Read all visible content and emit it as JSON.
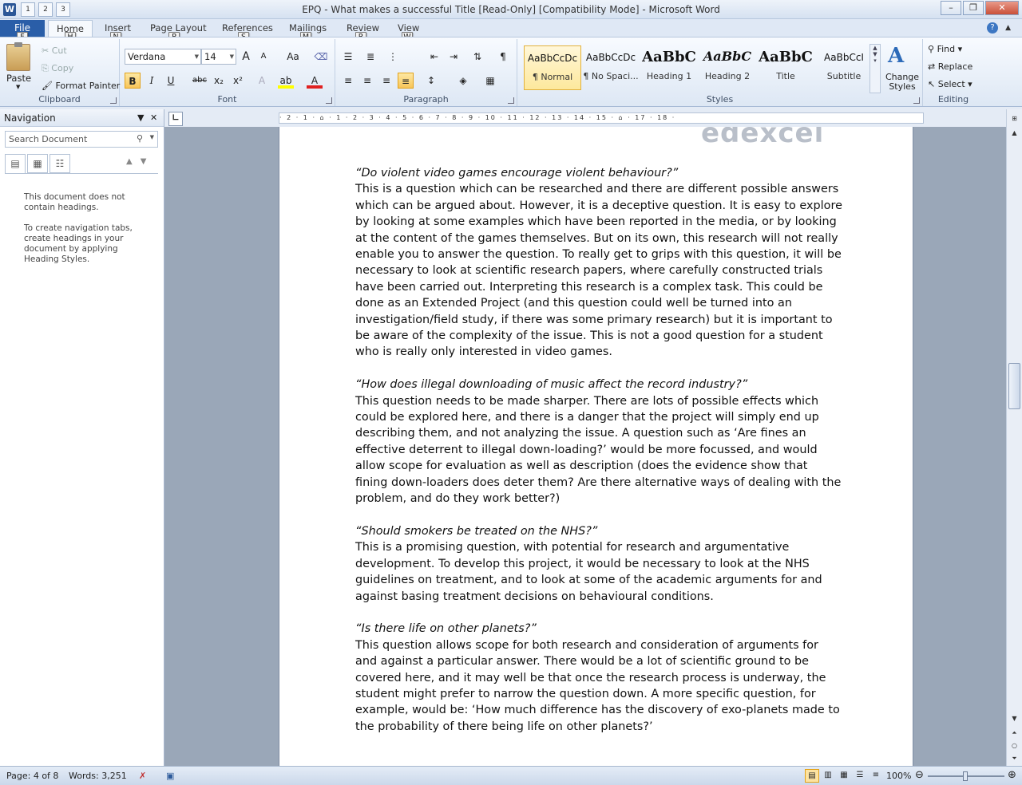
{
  "app": {
    "title": "EPQ - What makes a successful Title [Read-Only] [Compatibility Mode]  -  Microsoft Word",
    "icon_letter": "W"
  },
  "qat": {
    "tips": [
      "1",
      "2",
      "3"
    ]
  },
  "window_controls": {
    "minimize": "–",
    "restore": "❐",
    "close": "✕"
  },
  "tabs": [
    {
      "label": "File",
      "key": "F"
    },
    {
      "label": "Home",
      "key": "H"
    },
    {
      "label": "Insert",
      "key": "N"
    },
    {
      "label": "Page Layout",
      "key": "P"
    },
    {
      "label": "References",
      "key": "S"
    },
    {
      "label": "Mailings",
      "key": "M"
    },
    {
      "label": "Review",
      "key": "R"
    },
    {
      "label": "View",
      "key": "W"
    }
  ],
  "ribbon": {
    "clipboard": {
      "label": "Clipboard",
      "paste": "Paste",
      "cut": "Cut",
      "copy": "Copy",
      "format_painter": "Format Painter"
    },
    "font": {
      "label": "Font",
      "font_name": "Verdana",
      "font_size": "14",
      "bold": "B",
      "italic": "I",
      "underline": "U",
      "strike": "abc",
      "sub": "x₂",
      "sup": "x²",
      "grow": "A",
      "shrink": "A",
      "case": "Aa"
    },
    "paragraph": {
      "label": "Paragraph"
    },
    "styles": {
      "label": "Styles",
      "items": [
        {
          "preview": "AaBbCcDc",
          "name": "¶ Normal"
        },
        {
          "preview": "AaBbCcDc",
          "name": "¶ No Spaci..."
        },
        {
          "preview": "AaBbC",
          "name": "Heading 1"
        },
        {
          "preview": "AaBbC",
          "name": "Heading 2"
        },
        {
          "preview": "AaBbC",
          "name": "Title"
        },
        {
          "preview": "AaBbCcI",
          "name": "Subtitle"
        }
      ],
      "change_styles": "Change Styles"
    },
    "editing": {
      "label": "Editing",
      "find": "Find",
      "replace": "Replace",
      "select": "Select"
    }
  },
  "navigation": {
    "title": "Navigation",
    "search_placeholder": "Search Document",
    "msg1": "This document does not contain headings.",
    "msg2": "To create navigation tabs, create headings in your document by applying Heading Styles."
  },
  "ruler": {
    "text": "· 2 · 1 · ⌂ · 1 · 2 · 3 · 4 · 5 · 6 · 7 · 8 · 9 · 10 · 11 · 12 · 13 · 14 · 15 · ⌂ · 17 · 18 ·"
  },
  "document": {
    "logo": "edexcel",
    "sections": [
      {
        "question": "“Do violent video games encourage violent behaviour?”",
        "text": "This is a question which can be researched and there are different possible answers which can be argued about. However, it is a deceptive question. It is easy to explore by looking at some examples which have been reported in the media, or by looking at the content of the games themselves. But on its own, this research will not really enable you to answer the question. To really get to grips with this question, it will be necessary to look at scientific research papers, where carefully constructed trials have been carried out. Interpreting this research is a complex task. This could be done as an Extended Project (and this question could well be turned into an investigation/field study, if there was some primary research) but it is important to be aware of the complexity of the issue. This is not a good question for a student who is really only interested in video games."
      },
      {
        "question": "“How does illegal downloading of music affect the record industry?”",
        "text": "This question needs to be made sharper. There are lots of possible effects which could be explored here, and there is a danger that the project will simply end up describing them, and not analyzing the issue. A question such as ‘Are fines an effective deterrent to illegal down-loading?’ would be more focussed, and would allow scope for evaluation as well as description (does the evidence show that fining down-loaders does deter them? Are there alternative ways of dealing with the problem, and do they work better?)"
      },
      {
        "question": "“Should smokers be treated on the NHS?”",
        "text": "This is a promising question, with potential for research and argumentative development. To develop this project, it would be necessary to look at the NHS guidelines on treatment, and to look at some of the academic arguments for and against basing treatment decisions on behavioural conditions."
      },
      {
        "question": "“Is there life on other planets?”",
        "text": "This question allows scope for both research and consideration of arguments for and against a particular answer. There would be a lot of scientific ground to be covered here, and it may well be that once the research process is underway, the student might prefer to narrow the question down. A more specific question, for example, would be: ‘How much difference has the discovery of exo-planets made to the probability of there being life on other planets?’"
      }
    ]
  },
  "status": {
    "page": "Page: 4 of 8",
    "words": "Words: 3,251",
    "zoom": "100%",
    "zoom_level": 1.0
  }
}
